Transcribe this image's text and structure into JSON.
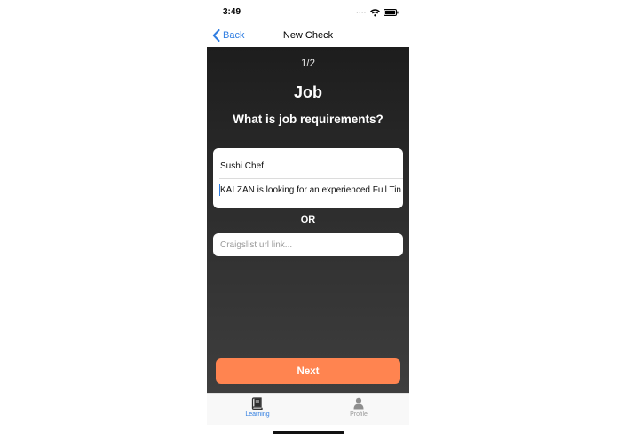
{
  "status_bar": {
    "time": "3:49",
    "signal": "....",
    "battery_level": 1.0
  },
  "nav": {
    "back_label": "Back",
    "title": "New Check"
  },
  "form": {
    "step": "1/2",
    "heading": "Job",
    "question": "What is job requirements?",
    "job_title_value": "Sushi Chef",
    "description_value": "KAI ZAN is looking for an experienced Full Tin",
    "or_label": "OR",
    "url_placeholder": "Craigslist url link..."
  },
  "next_label": "Next",
  "tab_bar": {
    "tabs": [
      {
        "label": "Learning",
        "icon": "book-icon",
        "active": true
      },
      {
        "label": "Profile",
        "icon": "person-icon",
        "active": false
      }
    ]
  },
  "colors": {
    "accent_blue": "#2f7de1",
    "next_orange": "#ff8450",
    "tab_inactive": "#9a9a9a",
    "background_dark": "#262626"
  }
}
